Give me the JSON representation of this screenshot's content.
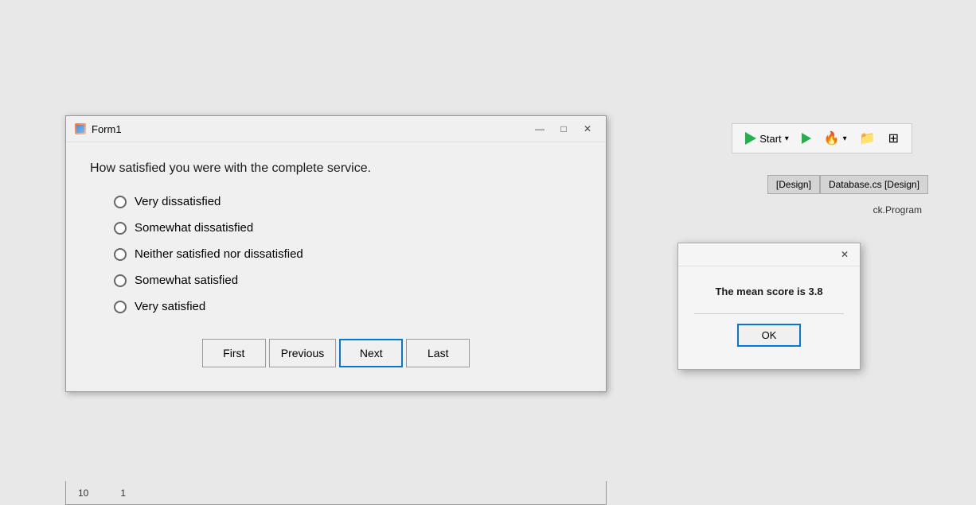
{
  "form1": {
    "title": "Form1",
    "question": "How satisfied you were with the complete service.",
    "radio_options": [
      {
        "id": "opt1",
        "label": "Very dissatisfied",
        "checked": false
      },
      {
        "id": "opt2",
        "label": "Somewhat dissatisfied",
        "checked": false
      },
      {
        "id": "opt3",
        "label": "Neither satisfied nor dissatisfied",
        "checked": false
      },
      {
        "id": "opt4",
        "label": "Somewhat satisfied",
        "checked": false
      },
      {
        "id": "opt5",
        "label": "Very satisfied",
        "checked": false
      }
    ],
    "buttons": {
      "first": "First",
      "previous": "Previous",
      "next": "Next",
      "last": "Last"
    }
  },
  "dialog": {
    "message": "The mean score is 3.8",
    "ok_label": "OK"
  },
  "toolbar": {
    "start_label": "Start",
    "tab1": "[Design]",
    "tab2": "Database.cs [Design]",
    "breadcrumb": "ck.Program"
  },
  "bottom": {
    "col1": "10",
    "col2": "1"
  },
  "icons": {
    "minimize": "—",
    "maximize": "□",
    "close": "✕",
    "dialog_close": "✕"
  }
}
